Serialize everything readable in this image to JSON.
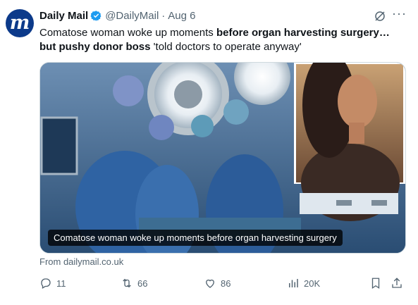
{
  "tweet": {
    "display_name": "Daily Mail",
    "handle": "@DailyMail",
    "separator": "·",
    "date": "Aug 6",
    "text_plain_1": "Comatose woman woke up moments ",
    "text_bold_1": "before organ harvesting surgery… but pushy donor boss",
    "text_plain_2": " 'told doctors to operate anyway'",
    "avatar_letter": "m",
    "more_label": "···"
  },
  "media": {
    "caption": "Comatose woman woke up moments before organ harvesting surgery"
  },
  "link_source": "From dailymail.co.uk",
  "actions": {
    "replies": "11",
    "reposts": "66",
    "likes": "86",
    "views": "20K"
  },
  "colors": {
    "brand": "#0c3a8a",
    "verified": "#1d9bf0",
    "muted": "#536471"
  },
  "icons": [
    "verified-badge-icon",
    "grok-icon",
    "more-icon",
    "reply-icon",
    "repost-icon",
    "like-icon",
    "views-icon",
    "bookmark-icon",
    "share-icon"
  ]
}
